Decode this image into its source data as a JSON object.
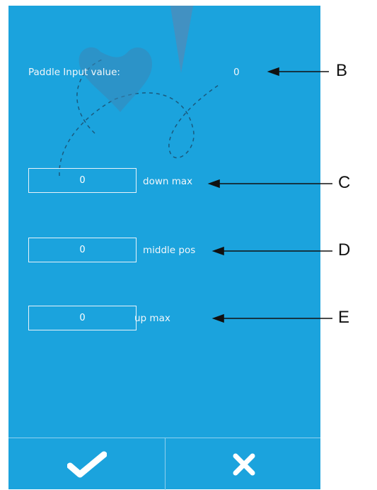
{
  "header": {
    "label": "Paddle Input value:",
    "value": "0"
  },
  "fields": [
    {
      "value": "0",
      "label": "down max"
    },
    {
      "value": "0",
      "label": "middle pos"
    },
    {
      "value": "0",
      "label": "up max"
    }
  ],
  "buttons": {
    "confirm_icon": "checkmark-icon",
    "cancel_icon": "close-icon"
  },
  "callouts": {
    "b": "B",
    "c": "C",
    "d": "D",
    "e": "E"
  },
  "colors": {
    "panel": "#1ba3dd",
    "text": "#f1f6fa"
  }
}
